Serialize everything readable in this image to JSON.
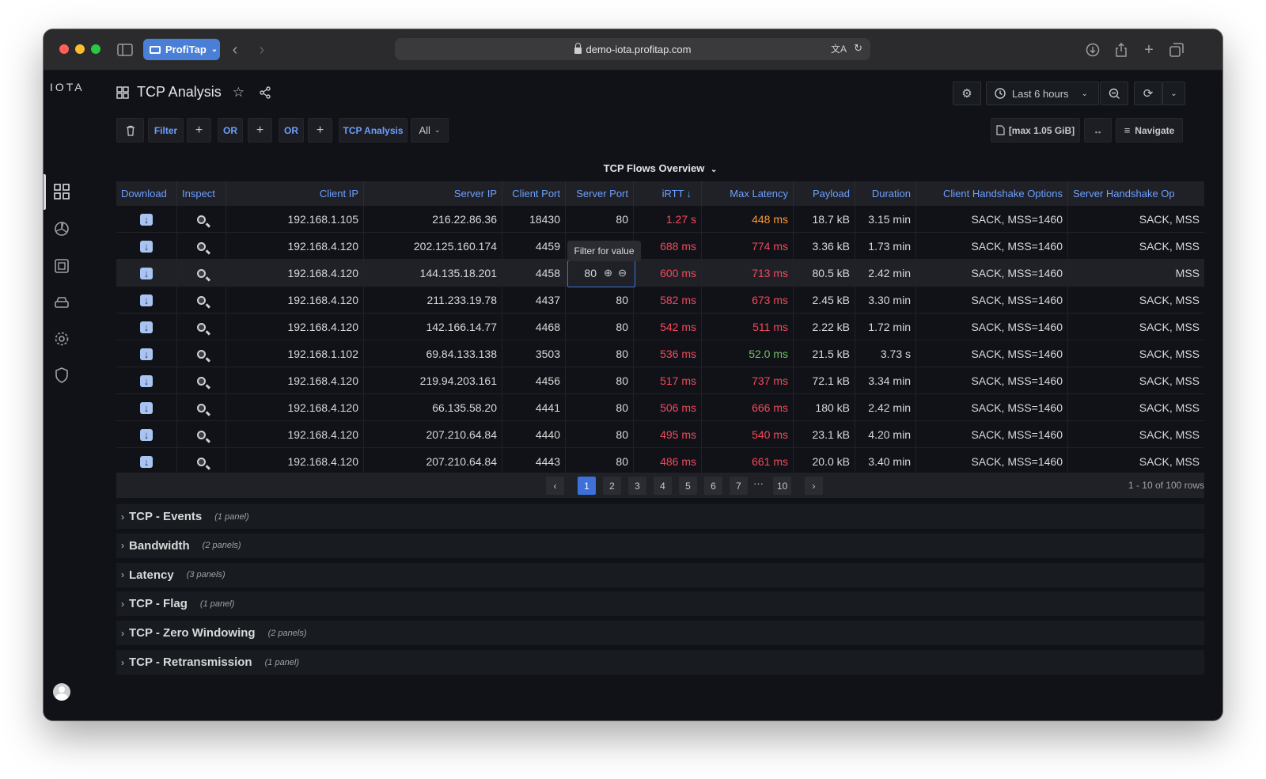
{
  "browser": {
    "profile_label": "ProfiTap",
    "url": "demo-iota.profitap.com"
  },
  "app": {
    "logo": "IOTA"
  },
  "header": {
    "title": "TCP Analysis",
    "time_range": "Last 6 hours"
  },
  "filter_bar": {
    "filter_label": "Filter",
    "or1_label": "OR",
    "or2_label": "OR",
    "tag_label": "TCP Analysis",
    "select_value": "All",
    "size_label": "[max 1.05 GiB]",
    "navigate_label": "Navigate"
  },
  "panel": {
    "title": "TCP Flows Overview",
    "columns": [
      "Download",
      "Inspect",
      "Client IP",
      "Server IP",
      "Client Port",
      "Server Port",
      "iRTT",
      "Max Latency",
      "Payload",
      "Duration",
      "Client Handshake Options",
      "Server Handshake Op"
    ],
    "sort_indicator": "↓",
    "rows": [
      {
        "client_ip": "192.168.1.105",
        "server_ip": "216.22.86.36",
        "client_port": "18430",
        "server_port": "80",
        "irtt": "1.27 s",
        "max_latency": "448 ms",
        "payload": "18.7 kB",
        "duration": "3.15 min",
        "client_opts": "SACK, MSS=1460",
        "server_opts": "SACK, MSS",
        "irtt_color": "#f2495c",
        "lat_color": "#ff9830"
      },
      {
        "client_ip": "192.168.4.120",
        "server_ip": "202.125.160.174",
        "client_port": "4459",
        "server_port": "",
        "irtt": "688 ms",
        "max_latency": "774 ms",
        "payload": "3.36 kB",
        "duration": "1.73 min",
        "client_opts": "SACK, MSS=1460",
        "server_opts": "SACK, MSS",
        "irtt_color": "#f2495c",
        "lat_color": "#f2495c"
      },
      {
        "client_ip": "192.168.4.120",
        "server_ip": "144.135.18.201",
        "client_port": "4458",
        "server_port": "80",
        "irtt": "600 ms",
        "max_latency": "713 ms",
        "payload": "80.5 kB",
        "duration": "2.42 min",
        "client_opts": "SACK, MSS=1460",
        "server_opts": "MSS",
        "irtt_color": "#f2495c",
        "lat_color": "#f2495c"
      },
      {
        "client_ip": "192.168.4.120",
        "server_ip": "211.233.19.78",
        "client_port": "4437",
        "server_port": "80",
        "irtt": "582 ms",
        "max_latency": "673 ms",
        "payload": "2.45 kB",
        "duration": "3.30 min",
        "client_opts": "SACK, MSS=1460",
        "server_opts": "SACK, MSS",
        "irtt_color": "#f2495c",
        "lat_color": "#f2495c"
      },
      {
        "client_ip": "192.168.4.120",
        "server_ip": "142.166.14.77",
        "client_port": "4468",
        "server_port": "80",
        "irtt": "542 ms",
        "max_latency": "511 ms",
        "payload": "2.22 kB",
        "duration": "1.72 min",
        "client_opts": "SACK, MSS=1460",
        "server_opts": "SACK, MSS",
        "irtt_color": "#f2495c",
        "lat_color": "#f2495c"
      },
      {
        "client_ip": "192.168.1.102",
        "server_ip": "69.84.133.138",
        "client_port": "3503",
        "server_port": "80",
        "irtt": "536 ms",
        "max_latency": "52.0 ms",
        "payload": "21.5 kB",
        "duration": "3.73 s",
        "client_opts": "SACK, MSS=1460",
        "server_opts": "SACK, MSS",
        "irtt_color": "#f2495c",
        "lat_color": "#73bf69"
      },
      {
        "client_ip": "192.168.4.120",
        "server_ip": "219.94.203.161",
        "client_port": "4456",
        "server_port": "80",
        "irtt": "517 ms",
        "max_latency": "737 ms",
        "payload": "72.1 kB",
        "duration": "3.34 min",
        "client_opts": "SACK, MSS=1460",
        "server_opts": "SACK, MSS",
        "irtt_color": "#f2495c",
        "lat_color": "#f2495c"
      },
      {
        "client_ip": "192.168.4.120",
        "server_ip": "66.135.58.20",
        "client_port": "4441",
        "server_port": "80",
        "irtt": "506 ms",
        "max_latency": "666 ms",
        "payload": "180 kB",
        "duration": "2.42 min",
        "client_opts": "SACK, MSS=1460",
        "server_opts": "SACK, MSS",
        "irtt_color": "#f2495c",
        "lat_color": "#f2495c"
      },
      {
        "client_ip": "192.168.4.120",
        "server_ip": "207.210.64.84",
        "client_port": "4440",
        "server_port": "80",
        "irtt": "495 ms",
        "max_latency": "540 ms",
        "payload": "23.1 kB",
        "duration": "4.20 min",
        "client_opts": "SACK, MSS=1460",
        "server_opts": "SACK, MSS",
        "irtt_color": "#f2495c",
        "lat_color": "#f2495c"
      },
      {
        "client_ip": "192.168.4.120",
        "server_ip": "207.210.64.84",
        "client_port": "4443",
        "server_port": "80",
        "irtt": "486 ms",
        "max_latency": "661 ms",
        "payload": "20.0 kB",
        "duration": "3.40 min",
        "client_opts": "SACK, MSS=1460",
        "server_opts": "SACK, MSS",
        "irtt_color": "#f2495c",
        "lat_color": "#f2495c"
      }
    ],
    "tooltip": "Filter for value"
  },
  "pagination": {
    "pages": [
      "1",
      "2",
      "3",
      "4",
      "5",
      "6",
      "7"
    ],
    "ellipsis": "···",
    "last_page": "10",
    "rows_info": "1 - 10 of 100 rows"
  },
  "sections": [
    {
      "name": "TCP - Events",
      "count": "(1 panel)"
    },
    {
      "name": "Bandwidth",
      "count": "(2 panels)"
    },
    {
      "name": "Latency",
      "count": "(3 panels)"
    },
    {
      "name": "TCP - Flag",
      "count": "(1 panel)"
    },
    {
      "name": "TCP - Zero Windowing",
      "count": "(2 panels)"
    },
    {
      "name": "TCP - Retransmission",
      "count": "(1 panel)"
    }
  ]
}
